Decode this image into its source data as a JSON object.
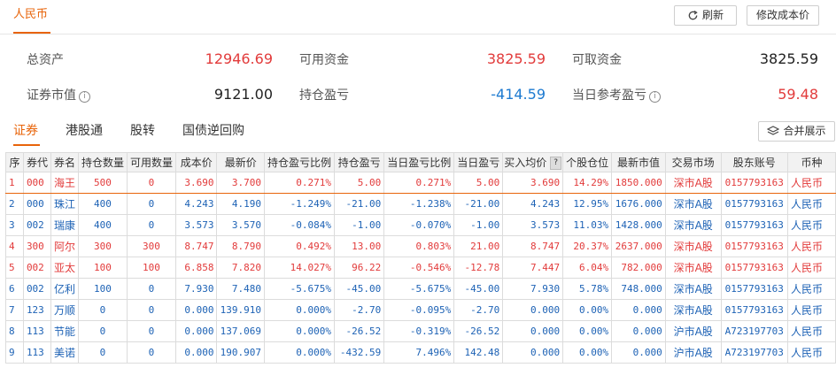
{
  "currency_tab": "人民币",
  "buttons": {
    "refresh": "刷新",
    "edit_cost": "修改成本价",
    "merge": "合并展示"
  },
  "summary": {
    "total_assets": {
      "label": "总资产",
      "value": "12946.69"
    },
    "available_funds": {
      "label": "可用资金",
      "value": "3825.59"
    },
    "withdrawable_funds": {
      "label": "可取资金",
      "value": "3825.59"
    },
    "market_value": {
      "label": "证券市值",
      "value": "9121.00"
    },
    "position_pnl": {
      "label": "持仓盈亏",
      "value": "-414.59"
    },
    "daily_ref_pnl": {
      "label": "当日参考盈亏",
      "value": "59.48"
    }
  },
  "subtabs": [
    "证券",
    "港股通",
    "股转",
    "国债逆回购"
  ],
  "table": {
    "headers": [
      "序",
      "券代",
      "券名",
      "持仓数量",
      "可用数量",
      "成本价",
      "最新价",
      "持仓盈亏比例",
      "持仓盈亏",
      "当日盈亏比例",
      "当日盈亏",
      "买入均价",
      "个股仓位",
      "最新市值",
      "交易市场",
      "股东账号",
      "币种"
    ],
    "header_help": "?",
    "rows": [
      {
        "color": "red",
        "cells": [
          "1",
          "000",
          "海王",
          "500",
          "0",
          "3.690",
          "3.700",
          "0.271%",
          "5.00",
          "0.271%",
          "5.00",
          "3.690",
          "14.29%",
          "1850.000",
          "深市A股",
          "0157793163",
          "人民币"
        ]
      },
      {
        "color": "blue",
        "cells": [
          "2",
          "000",
          "珠江",
          "400",
          "0",
          "4.243",
          "4.190",
          "-1.249%",
          "-21.00",
          "-1.238%",
          "-21.00",
          "4.243",
          "12.95%",
          "1676.000",
          "深市A股",
          "0157793163",
          "人民币"
        ]
      },
      {
        "color": "blue",
        "cells": [
          "3",
          "002",
          "瑞康",
          "400",
          "0",
          "3.573",
          "3.570",
          "-0.084%",
          "-1.00",
          "-0.070%",
          "-1.00",
          "3.573",
          "11.03%",
          "1428.000",
          "深市A股",
          "0157793163",
          "人民币"
        ]
      },
      {
        "color": "red",
        "cells": [
          "4",
          "300",
          "阿尔",
          "300",
          "300",
          "8.747",
          "8.790",
          "0.492%",
          "13.00",
          "0.803%",
          "21.00",
          "8.747",
          "20.37%",
          "2637.000",
          "深市A股",
          "0157793163",
          "人民币"
        ]
      },
      {
        "color": "red",
        "cells": [
          "5",
          "002",
          "亚太",
          "100",
          "100",
          "6.858",
          "7.820",
          "14.027%",
          "96.22",
          "-0.546%",
          "-12.78",
          "7.447",
          "6.04%",
          "782.000",
          "深市A股",
          "0157793163",
          "人民币"
        ]
      },
      {
        "color": "blue",
        "cells": [
          "6",
          "002",
          "亿利",
          "100",
          "0",
          "7.930",
          "7.480",
          "-5.675%",
          "-45.00",
          "-5.675%",
          "-45.00",
          "7.930",
          "5.78%",
          "748.000",
          "深市A股",
          "0157793163",
          "人民币"
        ]
      },
      {
        "color": "blue",
        "cells": [
          "7",
          "123",
          "万顺",
          "0",
          "0",
          "0.000",
          "139.910",
          "0.000%",
          "-2.70",
          "-0.095%",
          "-2.70",
          "0.000",
          "0.00%",
          "0.000",
          "深市A股",
          "0157793163",
          "人民币"
        ]
      },
      {
        "color": "blue",
        "cells": [
          "8",
          "113",
          "节能",
          "0",
          "0",
          "0.000",
          "137.069",
          "0.000%",
          "-26.52",
          "-0.319%",
          "-26.52",
          "0.000",
          "0.00%",
          "0.000",
          "沪市A股",
          "A723197703",
          "人民币"
        ]
      },
      {
        "color": "blue",
        "cells": [
          "9",
          "113",
          "美诺",
          "0",
          "0",
          "0.000",
          "190.907",
          "0.000%",
          "-432.59",
          "7.496%",
          "142.48",
          "0.000",
          "0.00%",
          "0.000",
          "沪市A股",
          "A723197703",
          "人民币"
        ]
      }
    ]
  }
}
